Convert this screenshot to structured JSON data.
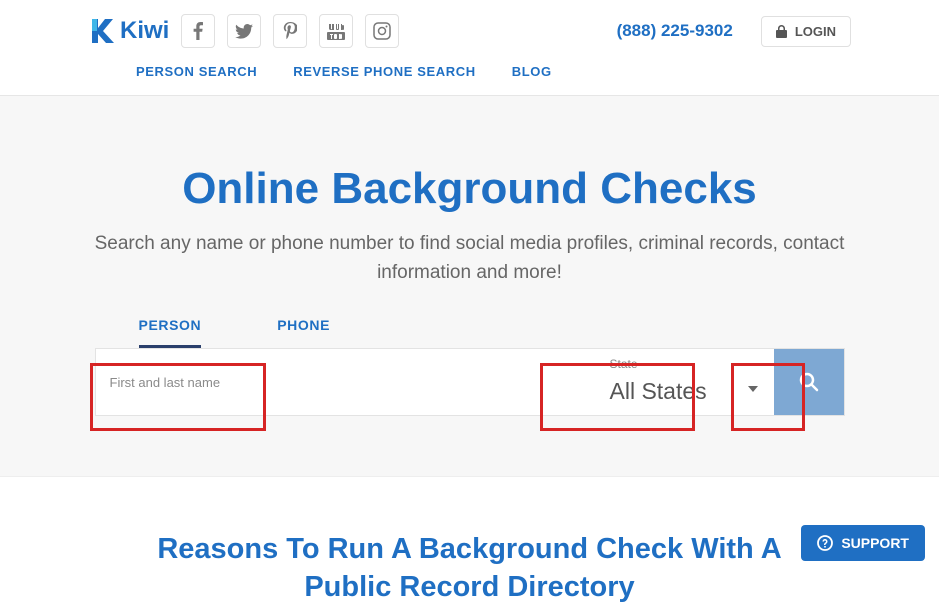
{
  "brand": {
    "name": "Kiwi"
  },
  "header": {
    "phone": "(888) 225-9302",
    "login_label": "LOGIN"
  },
  "social": [
    "facebook",
    "twitter",
    "pinterest",
    "youtube",
    "instagram"
  ],
  "nav": {
    "person_search": "PERSON SEARCH",
    "reverse_phone": "REVERSE PHONE SEARCH",
    "blog": "BLOG"
  },
  "hero": {
    "title": "Online Background Checks",
    "subtitle": "Search any name or phone number to find social media profiles, criminal records, contact information and more!"
  },
  "tabs": {
    "person": "PERSON",
    "phone": "PHONE"
  },
  "search": {
    "name_placeholder": "First and last name",
    "state_label": "State",
    "state_value": "All States"
  },
  "section2": {
    "title": "Reasons To Run A Background Check With A Public Record Directory"
  },
  "support": {
    "label": "SUPPORT"
  }
}
